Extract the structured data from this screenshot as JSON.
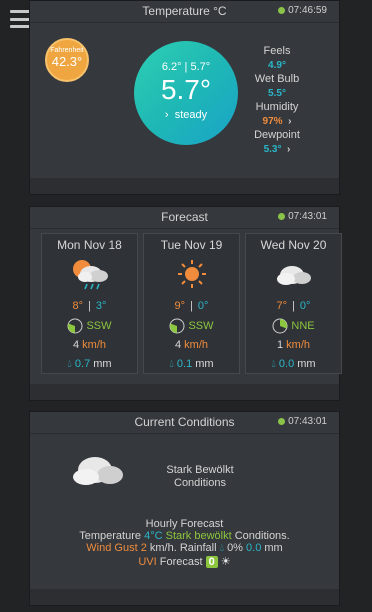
{
  "temperature": {
    "title": "Temperature °C",
    "time": "07:46:59",
    "fahrenheit_label": "Fahrenheit",
    "fahrenheit_value": "42.3°",
    "hilo": "6.2° | 5.7°",
    "current": "5.7°",
    "trend": "steady",
    "feels_label": "Feels",
    "feels_value": "4.9°",
    "wetbulb_label": "Wet Bulb",
    "wetbulb_value": "5.5°",
    "humidity_label": "Humidity",
    "humidity_value": "97%",
    "dewpoint_label": "Dewpoint",
    "dewpoint_value": "5.3°"
  },
  "forecast": {
    "title": "Forecast",
    "time": "07:43:01",
    "days": [
      {
        "day": "Mon Nov 18",
        "icon": "cloud-sun-rain-icon",
        "high": "8°",
        "low": "3°",
        "wind_dir": "SSW",
        "wind_speed": "4",
        "wind_unit": "km/h",
        "rain": "0.7",
        "rain_unit": "mm"
      },
      {
        "day": "Tue Nov 19",
        "icon": "sun-icon",
        "high": "9°",
        "low": "0°",
        "wind_dir": "SSW",
        "wind_speed": "4",
        "wind_unit": "km/h",
        "rain": "0.1",
        "rain_unit": "mm"
      },
      {
        "day": "Wed Nov 20",
        "icon": "cloud-icon",
        "high": "7°",
        "low": "0°",
        "wind_dir": "NNE",
        "wind_speed": "1",
        "wind_unit": "km/h",
        "rain": "0.0",
        "rain_unit": "mm"
      }
    ]
  },
  "current": {
    "title": "Current Conditions",
    "time": "07:43:01",
    "desc_line1": "Stark Bewölkt",
    "desc_line2": "Conditions",
    "hourly_title": "Hourly Forecast",
    "temp_label": "Temperature",
    "temp_value": "4°C",
    "cond_value": "Stark bewölkt",
    "cond_suffix": "Conditions.",
    "gust_label": "Wind Gust",
    "gust_value": "2",
    "gust_unit": "km/h. Rainfall",
    "rain_pct": "0%",
    "rain_value": "0.0",
    "rain_unit": "mm",
    "uvi_label": "UVI",
    "uvi_forecast_label": "Forecast",
    "uvi_value": "0"
  },
  "colors": {
    "accent_teal": "#2ab7c9",
    "accent_orange": "#f08c3c",
    "accent_green": "#8cc63f",
    "fahrenheit_badge": "#f0a640"
  }
}
